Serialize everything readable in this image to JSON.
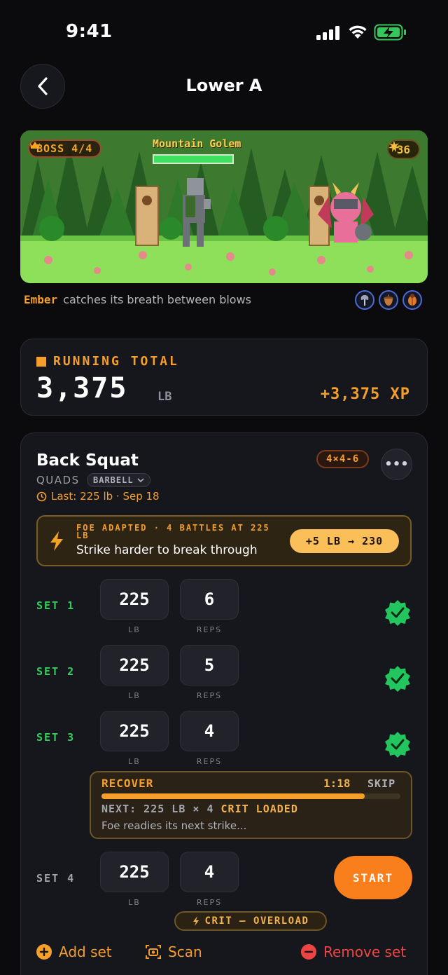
{
  "status_bar": {
    "time": "9:41"
  },
  "header": {
    "title": "Lower A"
  },
  "battle": {
    "boss_label": "BOSS 4/4",
    "boss_name": "Mountain Golem",
    "boss_hp": 1.0,
    "stars": "36",
    "character": "Ember",
    "caption": "catches its breath between blows",
    "badge_icons": [
      "axe-icon",
      "acorn-icon",
      "beetle-icon"
    ]
  },
  "running_total": {
    "label": "RUNNING TOTAL",
    "value": "3,375",
    "unit": "LB",
    "xp": "+3,375 XP"
  },
  "exercise": {
    "name": "Back Squat",
    "muscle": "QUADS",
    "equipment": "BARBELL",
    "last": "Last: 225 lb · Sep 18",
    "scheme": "4×4-6",
    "more": "•••",
    "adaptation": {
      "line1": "FOE ADAPTED · 4 BATTLES AT 225 LB",
      "line2": "Strike harder to break through",
      "suggestion": "+5 LB → 230"
    },
    "sets": [
      {
        "label": "SET 1",
        "weight": "225",
        "reps": "6",
        "done": true
      },
      {
        "label": "SET 2",
        "weight": "225",
        "reps": "5",
        "done": true
      },
      {
        "label": "SET 3",
        "weight": "225",
        "reps": "4",
        "done": true
      },
      {
        "label": "SET 4",
        "weight": "225",
        "reps": "4",
        "done": false
      }
    ],
    "unit_weight": "LB",
    "unit_reps": "REPS",
    "recover": {
      "title": "RECOVER",
      "time": "1:18",
      "skip": "SKIP",
      "progress": 0.88,
      "next_prefix": "NEXT: 225 LB × 4",
      "next_crit": "CRIT LOADED",
      "message": "Foe readies its next strike..."
    },
    "start_label": "START",
    "crit_label": "CRIT — OVERLOAD",
    "actions": {
      "add": "Add set",
      "scan": "Scan",
      "remove": "Remove set"
    }
  },
  "colors": {
    "accent": "#f59e2a",
    "success": "#2fd15a",
    "danger": "#ef4444",
    "background": "#0b0b0e",
    "card": "#16171c"
  }
}
